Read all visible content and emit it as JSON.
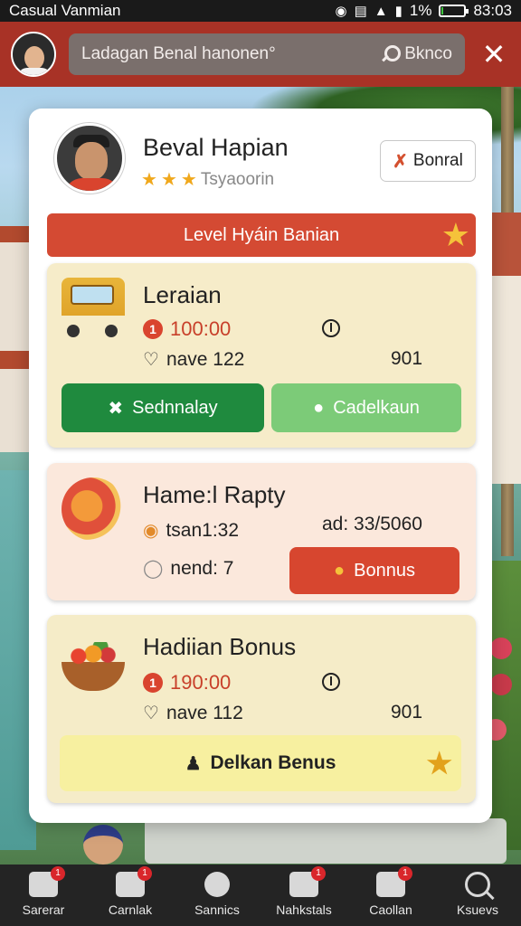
{
  "status_bar": {
    "carrier": "Casual Vanmian",
    "battery": "1%",
    "battery_level": 0.1,
    "time": "83:03"
  },
  "header": {
    "search_query": "Ladagan Benal hanonen°",
    "search_button": "Bknco",
    "close_symbol": "✕"
  },
  "profile": {
    "name": "Beval Hapian",
    "rank_label": "Tsyaoorin",
    "stars": 3,
    "bonus_button": "Bonral"
  },
  "level_banner": "Level Hyáin Banian",
  "offers": [
    {
      "title": "Leraian",
      "badge": "1",
      "price": "100:00",
      "stat_label": "nave 122",
      "stat_value": "901",
      "primary_button": "Sednnalay",
      "secondary_button": "Cadelkaun"
    },
    {
      "title": "Hame:l Rapty",
      "detail_1": "tsan1:32",
      "detail_2": "nend: 7",
      "side_value": "ad: 33/5060",
      "button": "Bonnus"
    },
    {
      "title": "Hadiian Bonus",
      "badge": "1",
      "price": "190:00",
      "stat_label": "nave 112",
      "stat_value": "901",
      "button": "Delkan Benus"
    }
  ],
  "bottom_nav": [
    {
      "label": "Sarerar",
      "icon": "home-icon",
      "badge": "1"
    },
    {
      "label": "Carnlak",
      "icon": "cards-icon",
      "badge": "1"
    },
    {
      "label": "Sannics",
      "icon": "ball-icon",
      "badge": ""
    },
    {
      "label": "Nahkstals",
      "icon": "shop-icon",
      "badge": "1"
    },
    {
      "label": "Caollan",
      "icon": "store-icon",
      "badge": "1"
    },
    {
      "label": "Ksuevs",
      "icon": "search-icon",
      "badge": ""
    }
  ]
}
